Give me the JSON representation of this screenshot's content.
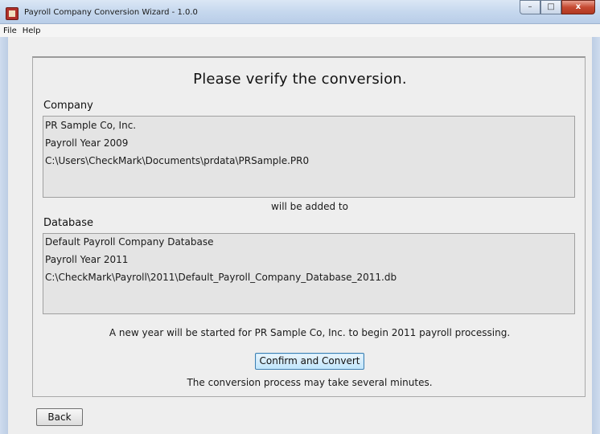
{
  "window": {
    "title": "Payroll Company Conversion Wizard - 1.0.0",
    "minimize_glyph": "–",
    "maximize_glyph": "□",
    "close_glyph": "x"
  },
  "menu": {
    "items": [
      {
        "label": "File"
      },
      {
        "label": "Help"
      }
    ]
  },
  "wizard": {
    "heading": "Please verify the conversion.",
    "company": {
      "label": "Company",
      "lines": [
        "PR Sample Co, Inc.",
        "Payroll Year 2009",
        "C:\\Users\\CheckMark\\Documents\\prdata\\PRSample.PR0"
      ]
    },
    "connector_text": "will be added to",
    "database": {
      "label": "Database",
      "lines": [
        "Default Payroll Company Database",
        "Payroll Year 2011",
        "C:\\CheckMark\\Payroll\\2011\\Default_Payroll_Company_Database_2011.db"
      ]
    },
    "new_year_message": "A new year will be started for PR Sample Co, Inc. to begin 2011 payroll processing.",
    "confirm_button": "Confirm and Convert",
    "duration_note": "The conversion process may take several minutes.",
    "back_button": "Back"
  }
}
